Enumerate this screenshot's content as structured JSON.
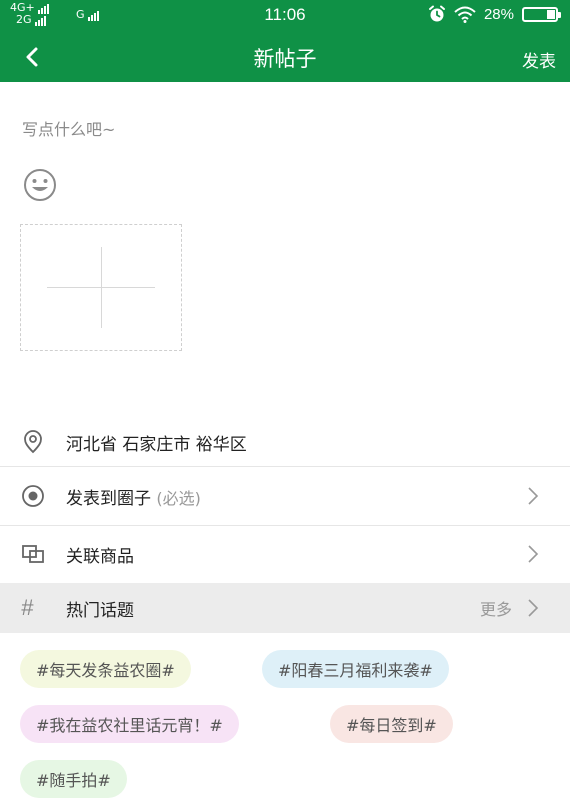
{
  "status_bar": {
    "network_left_top": "4G+",
    "network_left_bottom": "2G",
    "network_g": "G",
    "time": "11:06",
    "battery_percent": "28%",
    "battery_level": 0.28
  },
  "header": {
    "title": "新帖子",
    "publish_label": "发表"
  },
  "editor": {
    "placeholder": "写点什么吧~"
  },
  "location": {
    "text": "河北省 石家庄市 裕华区"
  },
  "circle": {
    "label": "发表到圈子",
    "hint": "(必选)"
  },
  "goods": {
    "label": "关联商品"
  },
  "hot_topics": {
    "label": "热门话题",
    "more_label": "更多",
    "tags": [
      "#每天发条益农圈#",
      "#阳春三月福利来袭#",
      "#我在益农社里话元宵！#",
      "#每日签到#",
      "#随手拍#"
    ]
  },
  "colors": {
    "brand_green": "#0f9146"
  },
  "icons": {
    "back": "back-arrow-icon",
    "emoji": "smiley-face-icon",
    "add": "plus-icon",
    "location": "location-pin-icon",
    "circle": "radio-target-icon",
    "goods": "link-goods-icon",
    "hash": "hash-icon",
    "chevron": "chevron-right-icon"
  }
}
